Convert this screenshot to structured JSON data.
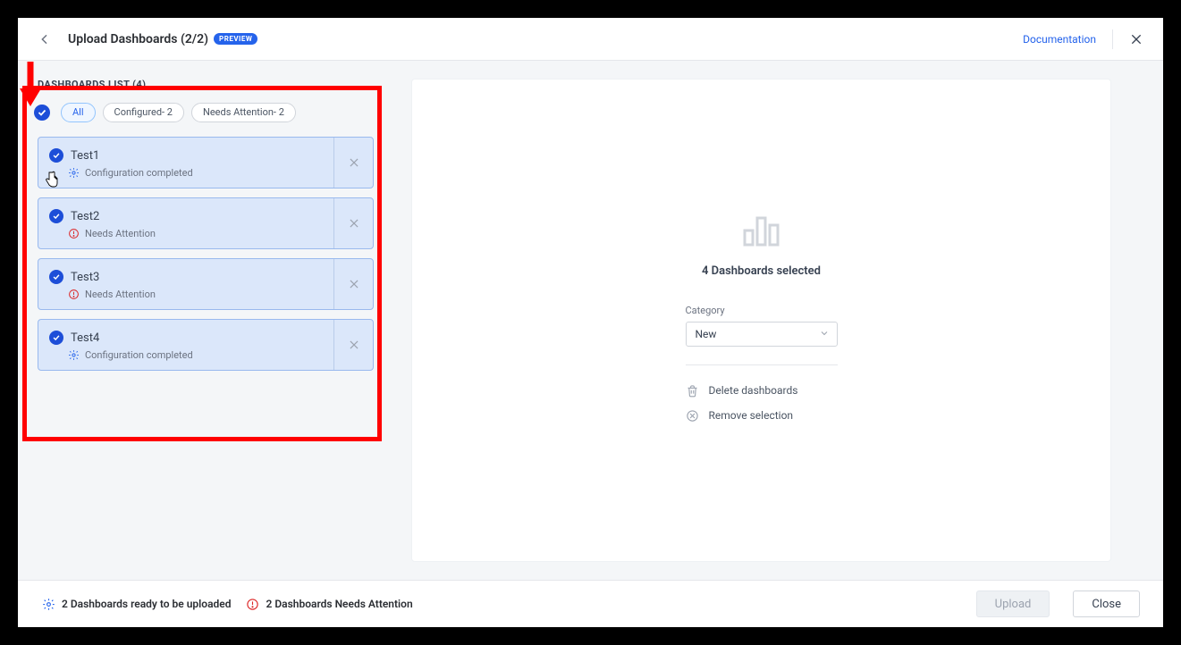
{
  "header": {
    "title": "Upload Dashboards (2/2)",
    "preview_badge": "PREVIEW",
    "documentation": "Documentation"
  },
  "list": {
    "title": "DASHBOARDS LIST (4)",
    "filters": {
      "all": "All",
      "configured": "Configured- 2",
      "needs": "Needs Attention- 2"
    },
    "items": [
      {
        "name": "Test1",
        "status_kind": "cog",
        "status": "Configuration completed"
      },
      {
        "name": "Test2",
        "status_kind": "warn",
        "status": "Needs Attention"
      },
      {
        "name": "Test3",
        "status_kind": "warn",
        "status": "Needs Attention"
      },
      {
        "name": "Test4",
        "status_kind": "cog",
        "status": "Configuration completed"
      }
    ]
  },
  "details": {
    "selected_title": "4 Dashboards selected",
    "category_label": "Category",
    "category_value": "New",
    "delete_label": "Delete dashboards",
    "remove_label": "Remove selection"
  },
  "footer": {
    "ready": "2 Dashboards ready to be uploaded",
    "attention": "2 Dashboards Needs Attention",
    "upload": "Upload",
    "close": "Close"
  }
}
